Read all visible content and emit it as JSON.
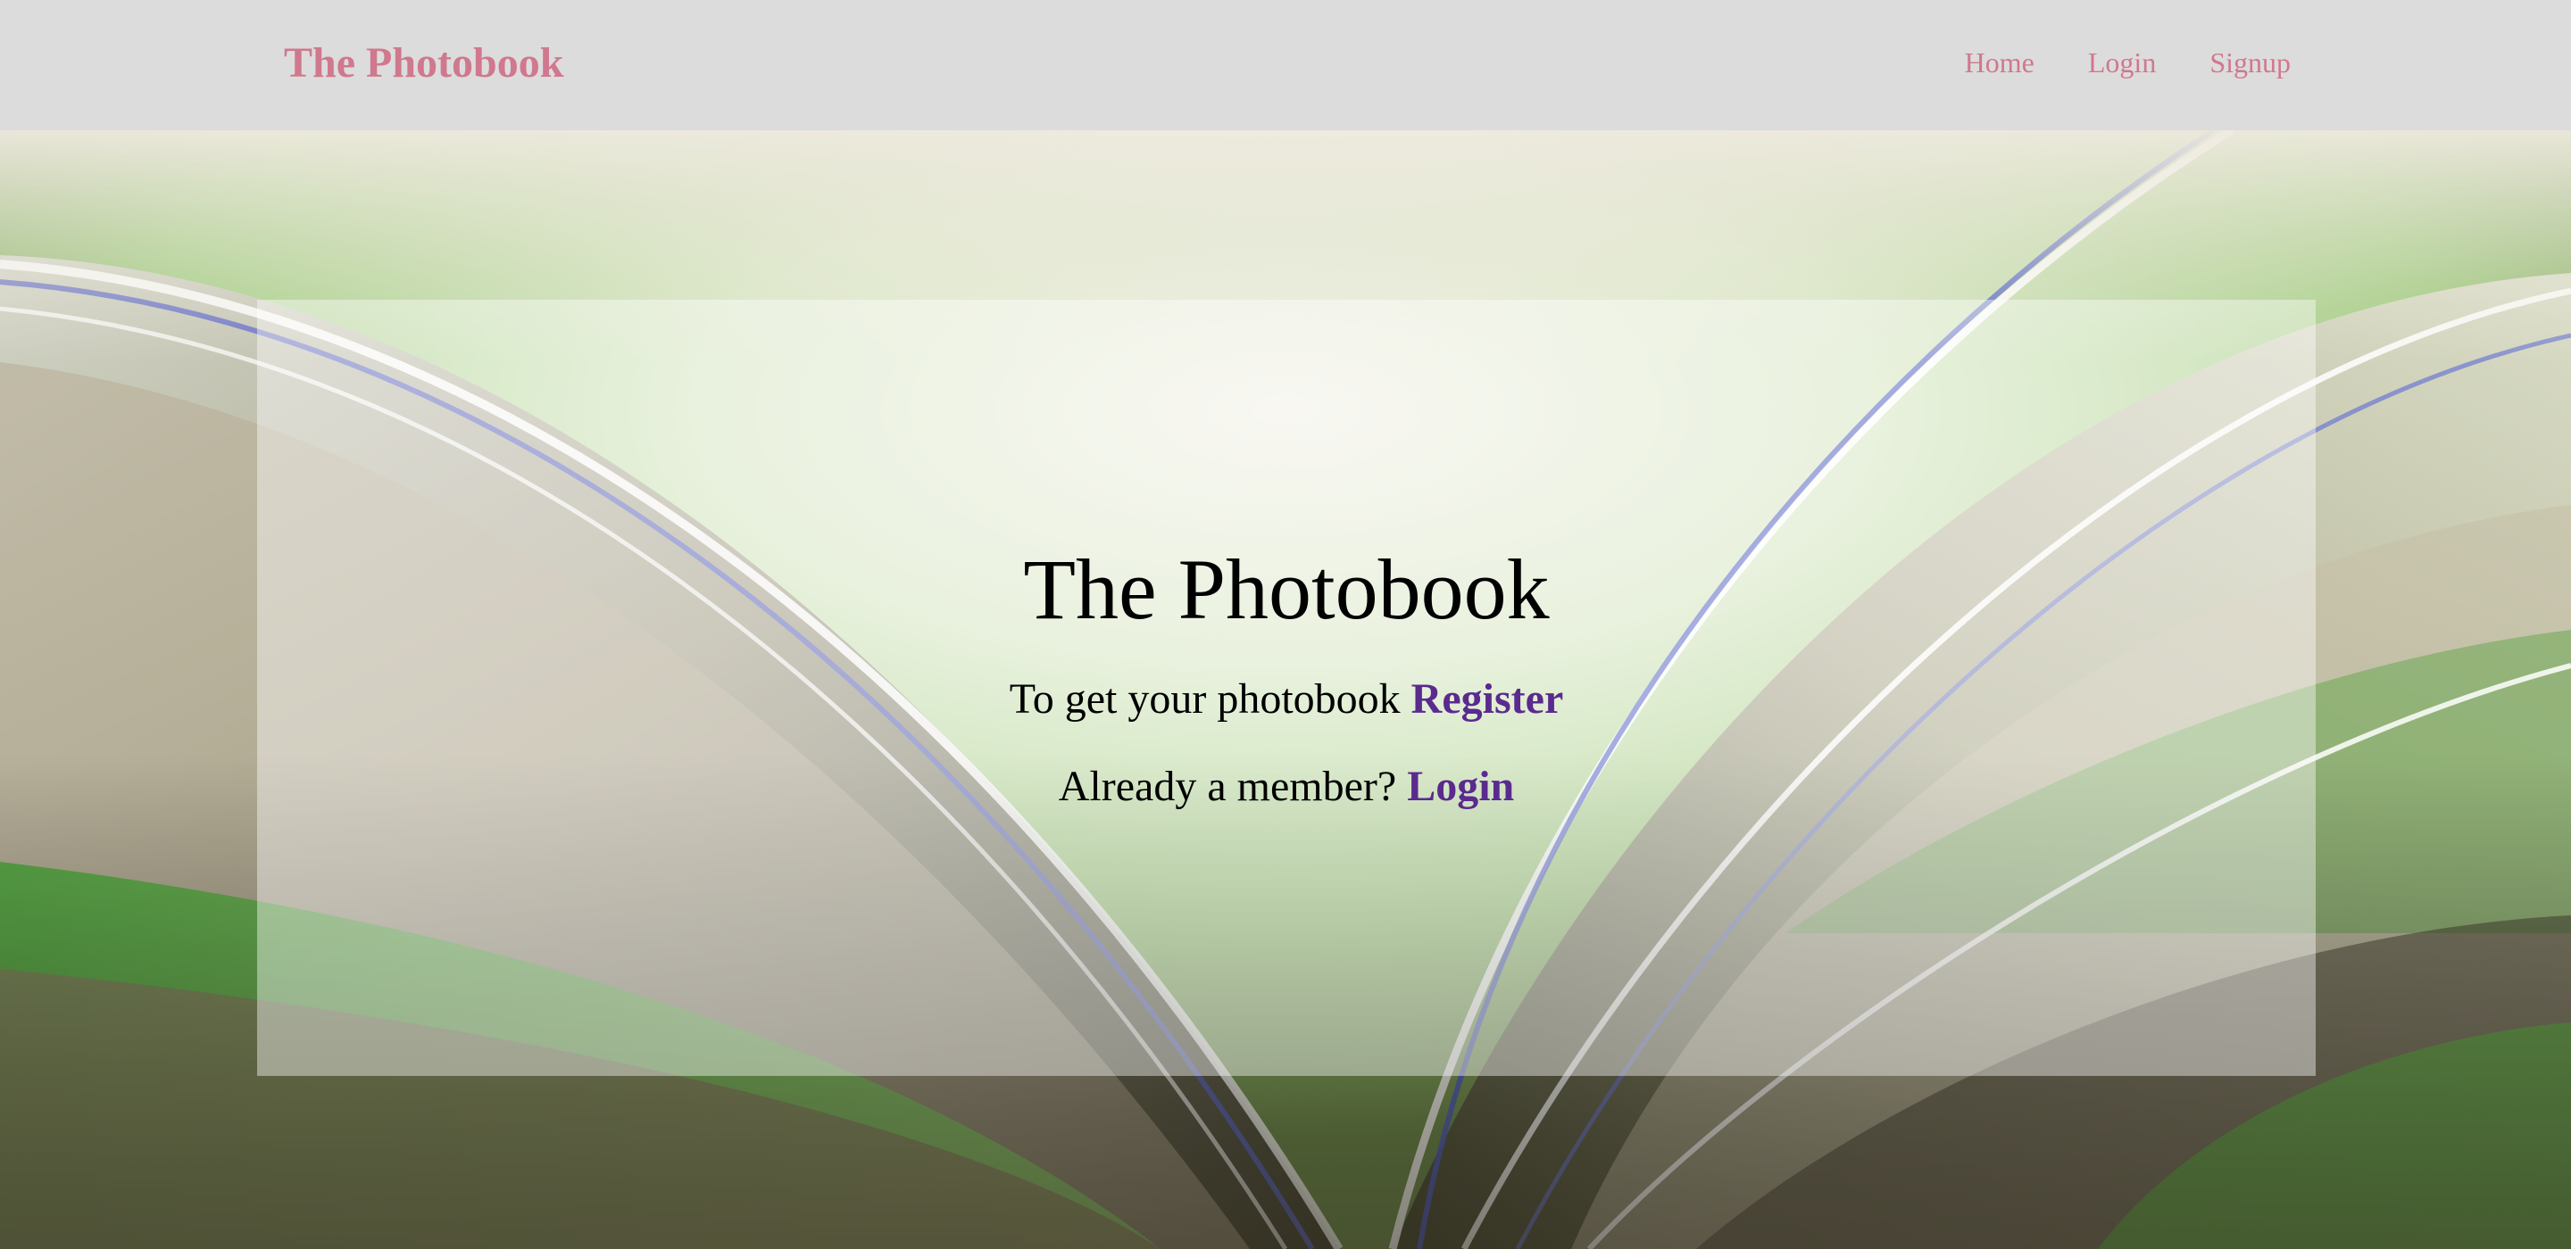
{
  "navbar": {
    "brand": "The Photobook",
    "links": [
      {
        "label": "Home"
      },
      {
        "label": "Login"
      },
      {
        "label": "Signup"
      }
    ],
    "background": "#dcdcdc",
    "link_color": "#d0788e"
  },
  "hero": {
    "title": "The Photobook",
    "register_prompt": "To get your photobook",
    "register_link": "Register",
    "login_prompt": "Already a member?",
    "login_link": "Login",
    "link_color": "#5a2a8e",
    "background_image": "open-book-pages-photo"
  }
}
